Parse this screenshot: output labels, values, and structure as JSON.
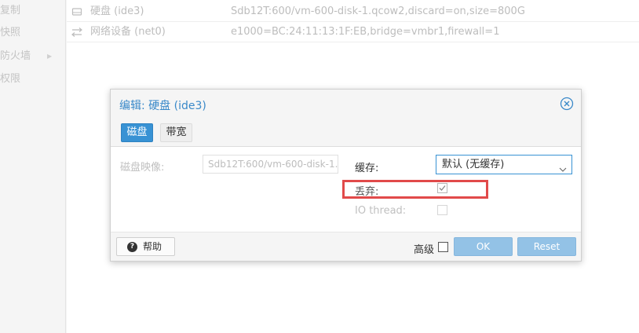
{
  "sidebar": {
    "items": [
      {
        "label": "复制"
      },
      {
        "label": "快照"
      },
      {
        "label": "防火墙",
        "has_submenu": true
      },
      {
        "label": "权限"
      }
    ]
  },
  "hardware": {
    "rows": [
      {
        "icon": "hard-disk-icon",
        "name": "硬盘 (ide3)",
        "value": "Sdb12T:600/vm-600-disk-1.qcow2,discard=on,size=800G"
      },
      {
        "icon": "network-icon",
        "name": "网络设备 (net0)",
        "value": "e1000=BC:24:11:13:1F:EB,bridge=vmbr1,firewall=1"
      }
    ]
  },
  "dialog": {
    "title": "编辑: 硬盘 (ide3)",
    "tabs": [
      {
        "label": "磁盘",
        "active": true
      },
      {
        "label": "带宽",
        "active": false
      }
    ],
    "fields": {
      "disk_image_label": "磁盘映像:",
      "disk_image_value": "Sdb12T:600/vm-600-disk-1.",
      "cache_label": "缓存:",
      "cache_value": "默认 (无缓存)",
      "discard_label": "丢弃:",
      "discard_checked": true,
      "iothread_label": "IO thread:",
      "iothread_checked": false
    },
    "footer": {
      "help_label": "帮助",
      "advanced_label": "高级",
      "advanced_checked": false,
      "ok_label": "OK",
      "reset_label": "Reset"
    }
  },
  "colors": {
    "accent": "#3892d4",
    "title": "#3a89c9",
    "highlight": "#e14a4a",
    "primary_button_disabled": "#93c2e6"
  }
}
